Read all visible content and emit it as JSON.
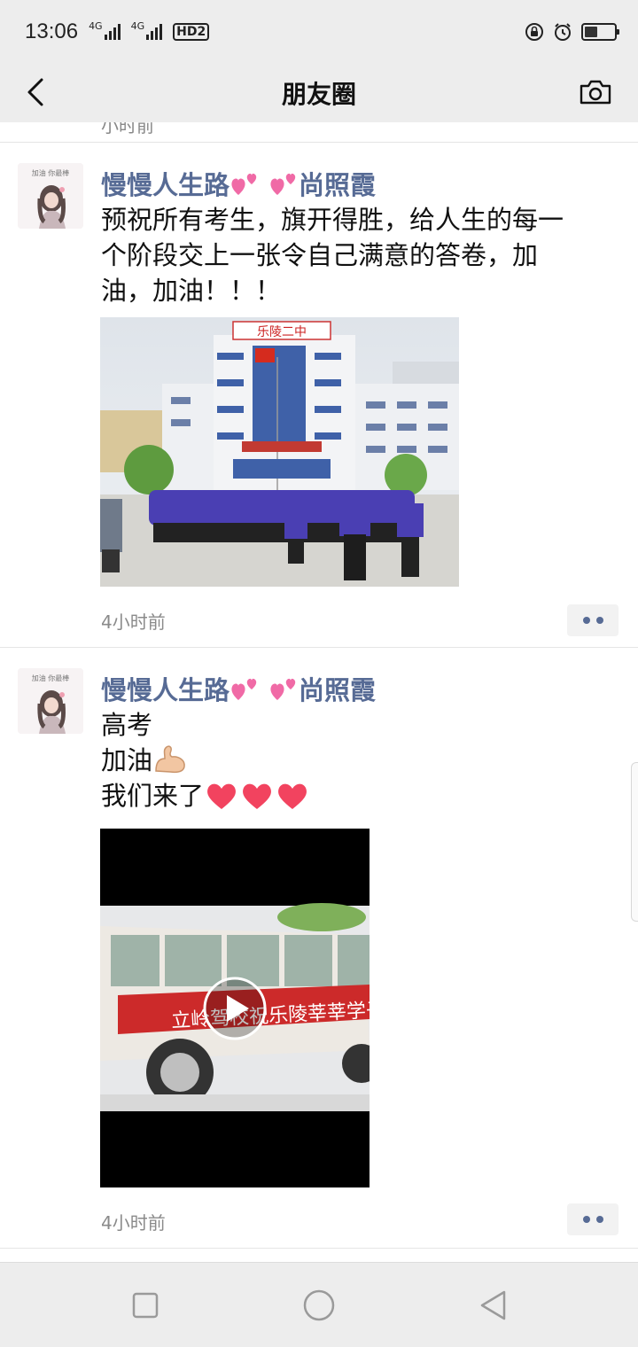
{
  "status_bar": {
    "time": "13:06",
    "network_1": "4G",
    "network_2": "4G",
    "hd_badge": "HD2",
    "battery_level": 0.45
  },
  "nav": {
    "title": "朋友圈",
    "back_icon": "chevron-left-icon",
    "camera_icon": "camera-icon"
  },
  "previous_post_fragment": "小时前",
  "posts": [
    {
      "author": "慢慢人生路",
      "author_suffix": "尚照霞",
      "text_lines": [
        "预祝所有考生，旗开得胜，给人生的每一",
        "个阶段交上一张令自己满意的答卷，加",
        "油，加油！！！"
      ],
      "photo_sign": "乐陵二中",
      "time": "4小时前"
    },
    {
      "author": "慢慢人生路",
      "author_suffix": "尚照霞",
      "text_lines": [
        "高考",
        "加油",
        "我们来了"
      ],
      "video_banner": "立岭驾校祝乐陵莘莘学子",
      "time": "4小时前"
    }
  ],
  "avatar_caption": "加油 你最棒",
  "system_nav": {
    "recent_icon": "square-icon",
    "home_icon": "circle-icon",
    "back_icon": "triangle-back-icon"
  },
  "colors": {
    "link": "#576b95",
    "bar_bg": "#ededed",
    "time_text": "#8a8a8a"
  }
}
